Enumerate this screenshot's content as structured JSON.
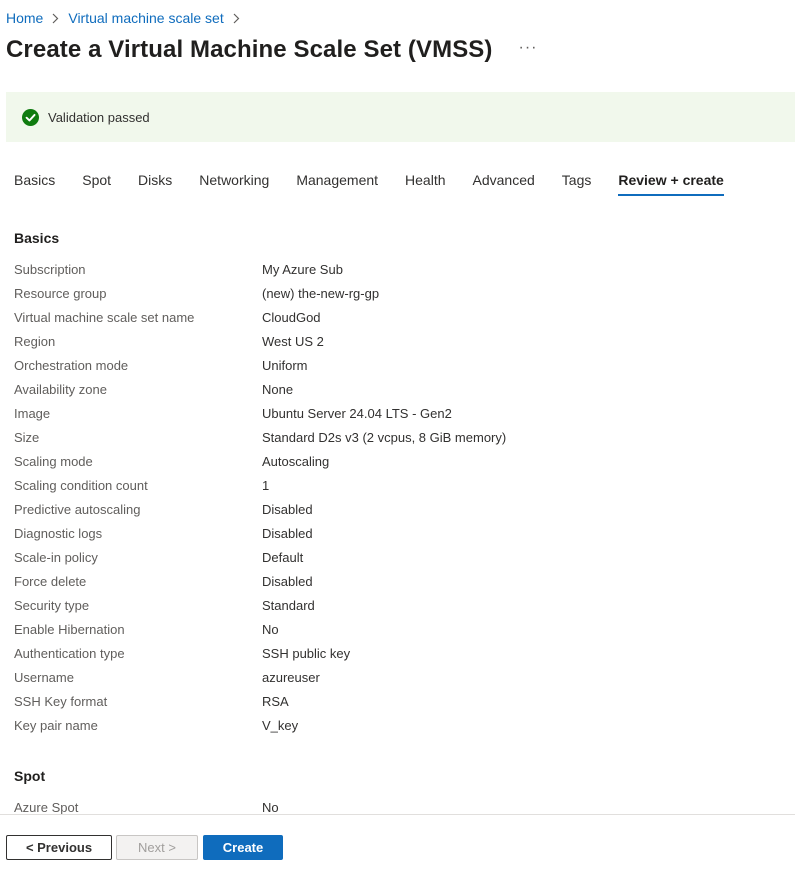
{
  "breadcrumb": {
    "items": [
      "Home",
      "Virtual machine scale set"
    ]
  },
  "header": {
    "title": "Create a Virtual Machine Scale Set (VMSS)",
    "more_label": "···"
  },
  "validation": {
    "text": "Validation passed",
    "color": "#107c10"
  },
  "tabs": [
    {
      "label": "Basics"
    },
    {
      "label": "Spot"
    },
    {
      "label": "Disks"
    },
    {
      "label": "Networking"
    },
    {
      "label": "Management"
    },
    {
      "label": "Health"
    },
    {
      "label": "Advanced"
    },
    {
      "label": "Tags"
    },
    {
      "label": "Review + create",
      "active": true
    }
  ],
  "sections": [
    {
      "title": "Basics",
      "rows": [
        {
          "label": "Subscription",
          "value": "My Azure Sub"
        },
        {
          "label": "Resource group",
          "value": "(new) the-new-rg-gp"
        },
        {
          "label": "Virtual machine scale set name",
          "value": "CloudGod"
        },
        {
          "label": "Region",
          "value": "West US 2"
        },
        {
          "label": "Orchestration mode",
          "value": "Uniform"
        },
        {
          "label": "Availability zone",
          "value": "None"
        },
        {
          "label": "Image",
          "value": "Ubuntu Server 24.04 LTS - Gen2"
        },
        {
          "label": "Size",
          "value": "Standard D2s v3 (2 vcpus, 8 GiB memory)"
        },
        {
          "label": "Scaling mode",
          "value": "Autoscaling"
        },
        {
          "label": "Scaling condition count",
          "value": "1"
        },
        {
          "label": "Predictive autoscaling",
          "value": "Disabled"
        },
        {
          "label": "Diagnostic logs",
          "value": "Disabled"
        },
        {
          "label": "Scale-in policy",
          "value": "Default"
        },
        {
          "label": "Force delete",
          "value": "Disabled"
        },
        {
          "label": "Security type",
          "value": "Standard"
        },
        {
          "label": "Enable Hibernation",
          "value": "No"
        },
        {
          "label": "Authentication type",
          "value": "SSH public key"
        },
        {
          "label": "Username",
          "value": "azureuser"
        },
        {
          "label": "SSH Key format",
          "value": "RSA"
        },
        {
          "label": "Key pair name",
          "value": "V_key"
        }
      ]
    },
    {
      "title": "Spot",
      "rows": [
        {
          "label": "Azure Spot",
          "value": "No"
        }
      ]
    }
  ],
  "footer": {
    "previous_label": "< Previous",
    "next_label": "Next >",
    "create_label": "Create",
    "accent_color": "#0f6cbd"
  }
}
